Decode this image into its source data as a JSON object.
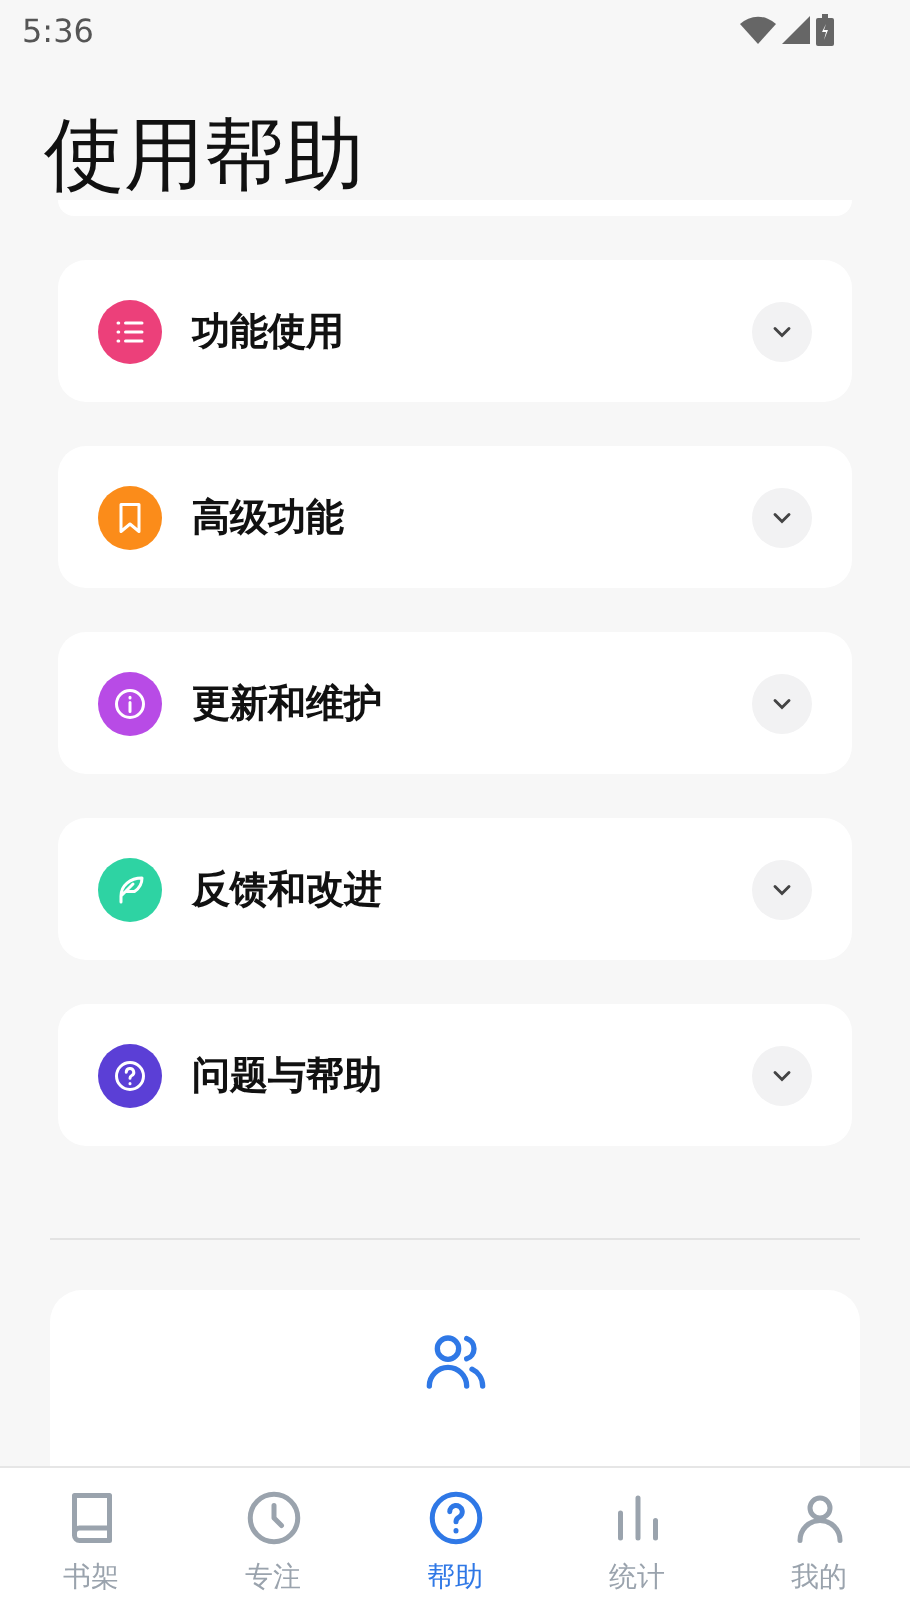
{
  "status_bar": {
    "time": "5:36"
  },
  "title": "使用帮助",
  "sections": [
    {
      "title": "功能使用",
      "kind": "list",
      "color": "#ec407a",
      "expanded": false
    },
    {
      "title": "高级功能",
      "kind": "bookmark",
      "color": "#fb8c1a",
      "expanded": false
    },
    {
      "title": "更新和维护",
      "kind": "info",
      "color": "#b84be6",
      "expanded": false
    },
    {
      "title": "反馈和改进",
      "kind": "feather",
      "color": "#2ed3a3",
      "expanded": false
    },
    {
      "title": "问题与帮助",
      "kind": "question",
      "color": "#5b3fd6",
      "expanded": false
    }
  ],
  "nav": [
    {
      "label": "书架",
      "kind": "book",
      "selected": false
    },
    {
      "label": "专注",
      "kind": "clock",
      "selected": false
    },
    {
      "label": "帮助",
      "kind": "help",
      "selected": true
    },
    {
      "label": "统计",
      "kind": "chart",
      "selected": false
    },
    {
      "label": "我的",
      "kind": "user",
      "selected": false
    }
  ]
}
